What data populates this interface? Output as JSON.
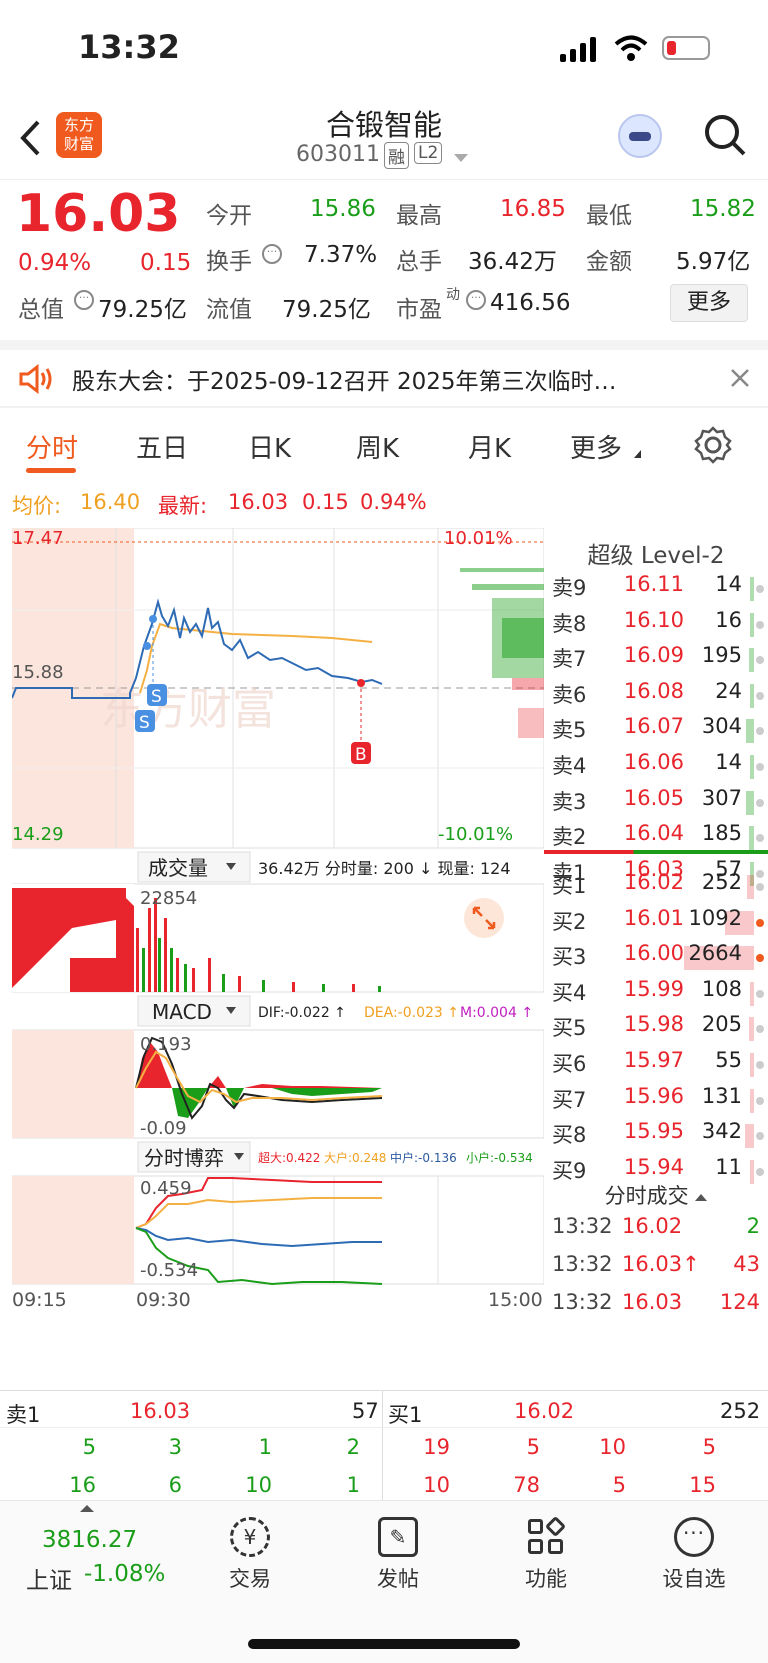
{
  "status": {
    "time": "13:32"
  },
  "header": {
    "name": "合锻智能",
    "code": "603011",
    "badge1": "融",
    "badge2": "L2",
    "logo_text_1": "东方",
    "logo_text_2": "财富"
  },
  "quote": {
    "price": "16.03",
    "pct": "0.94%",
    "chg": "0.15",
    "open_label": "今开",
    "open": "15.86",
    "high_label": "最高",
    "high": "16.85",
    "low_label": "最低",
    "low": "15.82",
    "turnover_label": "换手",
    "turnover": "7.37%",
    "vol_label": "总手",
    "vol": "36.42万",
    "amount_label": "金额",
    "amount": "5.97亿",
    "mcap_label": "总值",
    "mcap": "79.25亿",
    "float_label": "流值",
    "float": "79.25亿",
    "pe_label": "市盈",
    "pe_sup": "动",
    "pe": "416.56",
    "more": "更多"
  },
  "notice": {
    "text": "股东大会：于2025-09-12召开 2025年第三次临时…"
  },
  "tabs": [
    "分时",
    "五日",
    "日K",
    "周K",
    "月K",
    "更多"
  ],
  "avg": {
    "avg_label": "均价:",
    "avg": "16.40",
    "last_label": "最新:",
    "last": "16.03",
    "chg": "0.15",
    "pct": "0.94%"
  },
  "chart": {
    "top_price": "17.47",
    "top_pct": "10.01%",
    "mid_price": "15.88",
    "low_price": "14.29",
    "low_pct": "-10.01%",
    "vol_title": "成交量",
    "vol_info": "36.42万 分时量: 200 ↓ 现量: 124",
    "vol_max": "22854",
    "macd_title": "MACD",
    "dif": "DIF:-0.022 ↑",
    "dea": "DEA:-0.023 ↑",
    "m": "M:0.004 ↑",
    "macd_hi": "0.193",
    "macd_lo": "-0.09",
    "game_title": "分时博弈",
    "super": "超大:0.422",
    "large": "大户:0.248",
    "mid": "中户:-0.136",
    "small": "小户:-0.534",
    "game_hi": "0.459",
    "game_lo": "-0.534",
    "t_start": "09:15",
    "t_open": "09:30",
    "t_end": "15:00",
    "watermark": "东方财富",
    "markers": [
      "S",
      "S",
      "B"
    ]
  },
  "orderbook": {
    "title": "超级 Level-2",
    "asks": [
      {
        "label": "卖9",
        "price": "16.11",
        "vol": "14"
      },
      {
        "label": "卖8",
        "price": "16.10",
        "vol": "16"
      },
      {
        "label": "卖7",
        "price": "16.09",
        "vol": "195"
      },
      {
        "label": "卖6",
        "price": "16.08",
        "vol": "24"
      },
      {
        "label": "卖5",
        "price": "16.07",
        "vol": "304"
      },
      {
        "label": "卖4",
        "price": "16.06",
        "vol": "14"
      },
      {
        "label": "卖3",
        "price": "16.05",
        "vol": "307"
      },
      {
        "label": "卖2",
        "price": "16.04",
        "vol": "185"
      },
      {
        "label": "卖1",
        "price": "16.03",
        "vol": "57"
      }
    ],
    "bids": [
      {
        "label": "买1",
        "price": "16.02",
        "vol": "252"
      },
      {
        "label": "买2",
        "price": "16.01",
        "vol": "1092"
      },
      {
        "label": "买3",
        "price": "16.00",
        "vol": "2664"
      },
      {
        "label": "买4",
        "price": "15.99",
        "vol": "108"
      },
      {
        "label": "买5",
        "price": "15.98",
        "vol": "205"
      },
      {
        "label": "买6",
        "price": "15.97",
        "vol": "55"
      },
      {
        "label": "买7",
        "price": "15.96",
        "vol": "131"
      },
      {
        "label": "买8",
        "price": "15.95",
        "vol": "342"
      },
      {
        "label": "买9",
        "price": "15.94",
        "vol": "11"
      }
    ],
    "trades_title": "分时成交",
    "trades": [
      {
        "t": "13:32",
        "p": "16.02",
        "v": "2"
      },
      {
        "t": "13:32",
        "p": "16.03↑",
        "v": "43"
      },
      {
        "t": "13:32",
        "p": "16.03",
        "v": "124"
      }
    ]
  },
  "bottom": {
    "ask_label": "卖1",
    "ask_price": "16.03",
    "ask_vol": "57",
    "bid_label": "买1",
    "bid_price": "16.02",
    "bid_vol": "252",
    "ask_q1": [
      "5",
      "3",
      "1",
      "2"
    ],
    "ask_q2": [
      "16",
      "6",
      "10",
      "1"
    ],
    "bid_q1": [
      "19",
      "5",
      "10",
      "5"
    ],
    "bid_q2": [
      "10",
      "78",
      "5",
      "15"
    ]
  },
  "tabbar": {
    "index_value": "3816.27",
    "index_name": "上证",
    "index_pct": "-1.08%",
    "items": [
      "交易",
      "发帖",
      "功能",
      "设自选"
    ]
  }
}
